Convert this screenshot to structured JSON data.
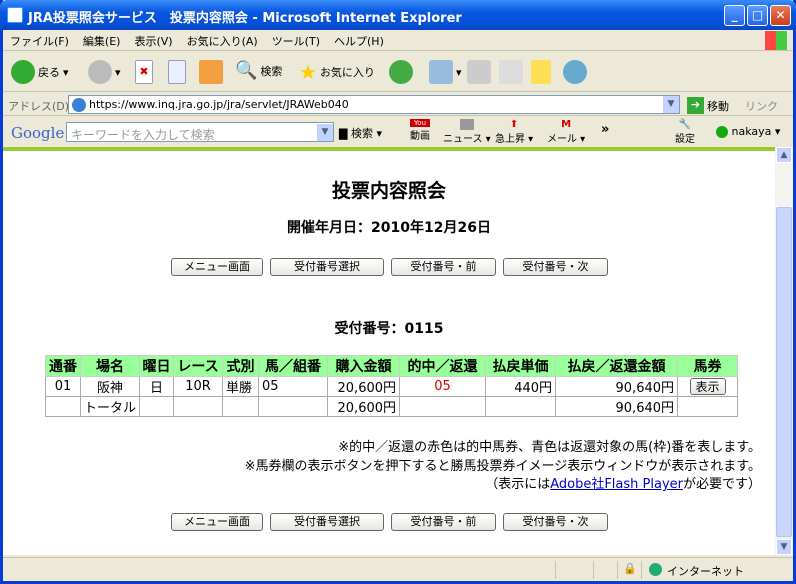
{
  "window": {
    "title": "JRA投票照会サービス　投票内容照会 - Microsoft Internet Explorer"
  },
  "menu": [
    "ファイル(F)",
    "編集(E)",
    "表示(V)",
    "お気に入り(A)",
    "ツール(T)",
    "ヘルプ(H)"
  ],
  "toolbar": {
    "back": "戻る",
    "search": "検索",
    "favorites": "お気に入り"
  },
  "address": {
    "label": "アドレス(D)",
    "url": "https://www.inq.jra.go.jp/jra/servlet/JRAWeb040",
    "go": "移動",
    "links": "リンク"
  },
  "google": {
    "logo": "Google",
    "placeholder": "キーワードを入力して検索",
    "search": "検索",
    "video": "動画",
    "news": "ニュース",
    "rising": "急上昇",
    "mail": "メール",
    "settings": "設定",
    "user": "nakaya",
    "more": "»"
  },
  "page": {
    "title": "投票内容照会",
    "date": "開催年月日：2010年12月26日",
    "buttons": [
      "メニュー画面",
      "受付番号選択",
      "受付番号・前",
      "受付番号・次"
    ],
    "receipt": "受付番号：0115",
    "headers": [
      "通番",
      "場名",
      "曜日",
      "レース",
      "式別",
      "馬／組番",
      "購入金額",
      "的中／返還",
      "払戻単価",
      "払戻／返還金額",
      "馬券"
    ],
    "row": {
      "no": "01",
      "venue": "阪神",
      "day": "日",
      "race": "10R",
      "type": "単勝",
      "horse": "05",
      "amount": "20,600円",
      "hit": "05",
      "unit": "440円",
      "payout": "90,640円",
      "ticket_btn": "表示"
    },
    "total": {
      "label": "トータル",
      "amount": "20,600円",
      "payout": "90,640円"
    },
    "notes": [
      "※的中／返還の赤色は的中馬券、青色は返還対象の馬(枠)番を表します。",
      "※馬券欄の表示ボタンを押下すると勝馬投票券イメージ表示ウィンドウが表示されます。"
    ],
    "note3_pre": "（表示には",
    "note3_link": "Adobe社Flash Player",
    "note3_post": "が必要です）"
  },
  "status": {
    "zone": "インターネット"
  }
}
